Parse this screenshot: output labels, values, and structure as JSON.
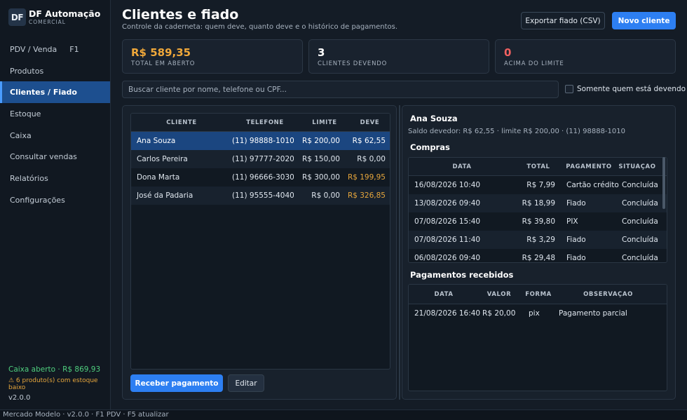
{
  "brand": {
    "logo": "DF",
    "name": "DF Automação",
    "sub": "COMERCIAL"
  },
  "nav": [
    {
      "label": "PDV / Venda",
      "shortcut": "F1"
    },
    {
      "label": "Produtos"
    },
    {
      "label": "Clientes / Fiado",
      "active": true
    },
    {
      "label": "Estoque"
    },
    {
      "label": "Caixa"
    },
    {
      "label": "Consultar vendas"
    },
    {
      "label": "Relatórios"
    },
    {
      "label": "Configurações"
    }
  ],
  "sidebar_footer": {
    "cash": "Caixa aberto · R$ 869,93",
    "stock_warning": "⚠ 6 produto(s) com estoque baixo",
    "version": "v2.0.0"
  },
  "statusbar": "Mercado Modelo  ·  v2.0.0  ·  F1 PDV · F5 atualizar",
  "header": {
    "title": "Clientes e fiado",
    "subtitle": "Controle da caderneta: quem deve, quanto deve e o histórico de pagamentos.",
    "export_label": "Exportar fiado (CSV)",
    "new_label": "Novo cliente"
  },
  "stats": [
    {
      "value": "R$ 589,35",
      "label": "TOTAL EM ABERTO",
      "color": "#f0a83a"
    },
    {
      "value": "3",
      "label": "CLIENTES DEVENDO",
      "color": "#ffffff"
    },
    {
      "value": "0",
      "label": "ACIMA DO LIMITE",
      "color": "#f06060"
    }
  ],
  "search": {
    "placeholder": "Buscar cliente por nome, telefone ou CPF...",
    "value": ""
  },
  "filter_label": "Somente quem está devendo",
  "clients": {
    "headers": [
      "CLIENTE",
      "TELEFONE",
      "LIMITE",
      "DEVE"
    ],
    "rows": [
      {
        "name": "Ana Souza",
        "phone": "(11) 98888-1010",
        "limit": "R$ 200,00",
        "owes": "R$ 62,55"
      },
      {
        "name": "Carlos Pereira",
        "phone": "(11) 97777-2020",
        "limit": "R$ 150,00",
        "owes": "R$ 0,00"
      },
      {
        "name": "Dona Marta",
        "phone": "(11) 96666-3030",
        "limit": "R$ 300,00",
        "owes": "R$ 199,95"
      },
      {
        "name": "José da Padaria",
        "phone": "(11) 95555-4040",
        "limit": "R$ 0,00",
        "owes": "R$ 326,85"
      }
    ],
    "selected_index": 0
  },
  "actions": {
    "receive_label": "Receber pagamento",
    "edit_label": "Editar"
  },
  "detail": {
    "name": "Ana Souza",
    "info": "Saldo devedor: R$ 62,55  ·  limite R$ 200,00  ·  (11) 98888-1010",
    "purchases_title": "Compras",
    "purchases_headers": [
      "DATA",
      "TOTAL",
      "PAGAMENTO",
      "SITUAÇÃO"
    ],
    "purchases": [
      {
        "date": "16/08/2026 10:40",
        "total": "R$ 7,99",
        "payment": "Cartão crédito",
        "status": "Concluída"
      },
      {
        "date": "13/08/2026 09:40",
        "total": "R$ 18,99",
        "payment": "Fiado",
        "status": "Concluída"
      },
      {
        "date": "07/08/2026 15:40",
        "total": "R$ 39,80",
        "payment": "PIX",
        "status": "Concluída"
      },
      {
        "date": "07/08/2026 11:40",
        "total": "R$ 3,29",
        "payment": "Fiado",
        "status": "Concluída"
      },
      {
        "date": "06/08/2026 09:40",
        "total": "R$ 29,48",
        "payment": "Fiado",
        "status": "Concluída"
      }
    ],
    "payments_title": "Pagamentos recebidos",
    "payments_headers": [
      "DATA",
      "VALOR",
      "FORMA",
      "OBSERVAÇÃO"
    ],
    "payments": [
      {
        "date": "21/08/2026 16:40",
        "value": "R$ 20,00",
        "method": "pix",
        "note": "Pagamento parcial"
      }
    ]
  }
}
